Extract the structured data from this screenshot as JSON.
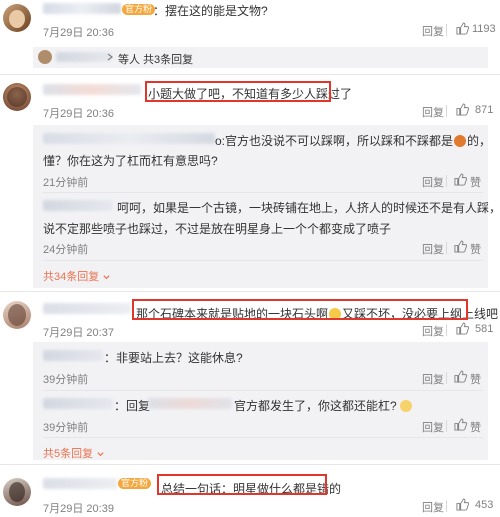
{
  "comments": [
    {
      "badge": "官方粉",
      "text": "：摆在这的能是文物?",
      "time": "7月29日 20:36",
      "reply": "回复",
      "likes": "1193",
      "sub_summary": "等人 共3条回复"
    },
    {
      "text": "小题大做了吧，不知道有多少人踩过了",
      "time": "7月29日 20:36",
      "reply": "回复",
      "likes": "871",
      "replies": [
        {
          "text_line1": "o:官方也没说不可以踩啊，所以踩和不踩都是",
          "text_line1_tail": "的，",
          "text_line2": "懂？你在这为了杠而杠有意思吗?",
          "time": "21分钟前",
          "reply": "回复",
          "like": "赞"
        },
        {
          "text_line1": "呵呵，如果是一个古镜，一块砖铺在地上，人挤人的时候还不是有人踩，",
          "text_line2": "说不定那些喷子也踩过，不过是放在明星身上一个个都变成了喷子",
          "time": "24分钟前",
          "reply": "回复",
          "like": "赞"
        }
      ],
      "sub_summary": "共34条回复"
    },
    {
      "text": "那个石碑本来就是贴地的一块石头啊",
      "text_tail": "又踩不坏，没必要上纲上线吧",
      "time": "7月29日 20:37",
      "reply": "回复",
      "likes": "581",
      "replies": [
        {
          "text": "：非要站上去？这能休息?",
          "time": "39分钟前",
          "reply": "回复",
          "like": "赞"
        },
        {
          "text_a": "：回复",
          "text_b": "官方都发生了，你这都还能杠?",
          "time": "39分钟前",
          "reply": "回复",
          "like": "赞"
        }
      ],
      "sub_summary": "共5条回复"
    },
    {
      "badge": "官方粉",
      "text": "总结一句话：明星做什么都是错的",
      "time": "7月29日 20:39",
      "reply": "回复",
      "likes": "453"
    }
  ]
}
